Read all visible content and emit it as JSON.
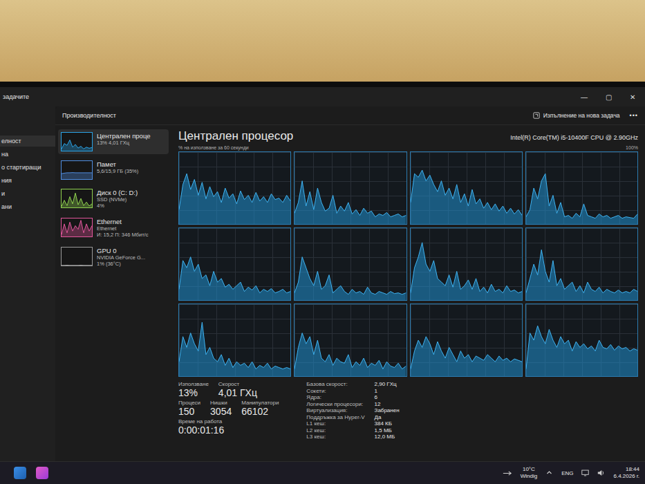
{
  "window": {
    "title": "задачите",
    "controls": [
      "—",
      "▢",
      "✕"
    ]
  },
  "nav": {
    "items": [
      {
        "label": "елност",
        "selected": true
      },
      {
        "label": "на",
        "selected": false
      },
      {
        "label": "о стартиращи",
        "selected": false
      },
      {
        "label": "ния",
        "selected": false
      },
      {
        "label": "и",
        "selected": false
      },
      {
        "label": "ани",
        "selected": false
      }
    ]
  },
  "header": {
    "title": "Производителност",
    "action": "Изпълнение на нова задача",
    "more": "•••"
  },
  "sidebar": {
    "items": [
      {
        "name": "Централен проце",
        "details": [
          "13% 4,01 ГХц"
        ],
        "selected": true,
        "color": "#2aa3e6",
        "graph": [
          10,
          40,
          30,
          60,
          20,
          35,
          15,
          25,
          10,
          20,
          14,
          18
        ]
      },
      {
        "name": "Памет",
        "details": [
          "5,6/15,9 ГБ (35%)"
        ],
        "selected": false,
        "color": "#4f8de0",
        "graph": [
          30,
          33,
          35,
          35,
          36,
          35,
          35,
          35,
          35,
          35,
          35,
          35
        ]
      },
      {
        "name": "Диск 0 (C: D:)",
        "details": [
          "SSD (NVMe)",
          "4%"
        ],
        "selected": false,
        "color": "#8fd14f",
        "graph": [
          5,
          40,
          10,
          60,
          20,
          80,
          15,
          50,
          10,
          30,
          8,
          20
        ]
      },
      {
        "name": "Ethernet",
        "details": [
          "Ethernet",
          "И: 15,2 П: 346 Мбит/с"
        ],
        "selected": false,
        "color": "#e0569b",
        "graph": [
          10,
          70,
          20,
          80,
          30,
          60,
          40,
          90,
          20,
          70,
          30,
          60
        ]
      },
      {
        "name": "GPU 0",
        "details": [
          "NVIDIA GeForce G...",
          "1% (36°C)"
        ],
        "selected": false,
        "color": "#9a9a9a",
        "graph": [
          1,
          1,
          2,
          1,
          1,
          1,
          1,
          2,
          1,
          1,
          1,
          1
        ]
      }
    ]
  },
  "panel": {
    "title": "Централен процесор",
    "model": "Intel(R) Core(TM) i5-10400F CPU @ 2.90GHz",
    "axis_label": "% на използване за 60 секунди",
    "axis_max": "100%",
    "cores": [
      {
        "values": [
          20,
          55,
          70,
          48,
          62,
          40,
          58,
          35,
          52,
          38,
          45,
          30,
          50,
          36,
          42,
          28,
          46,
          34,
          40,
          30,
          44,
          32,
          38,
          30,
          42,
          34,
          36,
          30,
          40,
          32
        ]
      },
      {
        "values": [
          15,
          30,
          60,
          25,
          45,
          20,
          50,
          30,
          18,
          22,
          40,
          15,
          25,
          18,
          30,
          14,
          20,
          12,
          22,
          15,
          18,
          10,
          14,
          12,
          16,
          10,
          12,
          14,
          10,
          12
        ]
      },
      {
        "values": [
          30,
          70,
          65,
          75,
          60,
          68,
          55,
          45,
          60,
          40,
          50,
          35,
          55,
          30,
          42,
          25,
          48,
          28,
          35,
          22,
          30,
          20,
          28,
          18,
          25,
          15,
          22,
          14,
          20,
          12
        ]
      },
      {
        "values": [
          10,
          20,
          50,
          35,
          60,
          70,
          25,
          40,
          15,
          30,
          10,
          12,
          8,
          15,
          10,
          28,
          12,
          10,
          8,
          14,
          10,
          12,
          8,
          10,
          12,
          8,
          10,
          9,
          8,
          14
        ]
      },
      {
        "values": [
          15,
          55,
          45,
          60,
          40,
          50,
          30,
          35,
          20,
          40,
          25,
          30,
          18,
          22,
          15,
          20,
          25,
          12,
          18,
          14,
          20,
          10,
          15,
          12,
          16,
          10,
          12,
          15,
          10,
          12
        ]
      },
      {
        "values": [
          10,
          25,
          60,
          45,
          30,
          20,
          40,
          15,
          20,
          35,
          10,
          15,
          20,
          12,
          8,
          15,
          10,
          12,
          8,
          18,
          10,
          8,
          12,
          10,
          8,
          12,
          9,
          10,
          8,
          10
        ]
      },
      {
        "values": [
          10,
          45,
          60,
          80,
          50,
          40,
          55,
          30,
          25,
          20,
          35,
          18,
          40,
          15,
          20,
          28,
          15,
          30,
          12,
          18,
          10,
          22,
          12,
          15,
          10,
          20,
          12,
          14,
          10,
          12
        ]
      },
      {
        "values": [
          10,
          30,
          50,
          35,
          70,
          40,
          25,
          55,
          20,
          30,
          15,
          20,
          25,
          12,
          20,
          10,
          25,
          15,
          12,
          18,
          10,
          15,
          12,
          10,
          14,
          10,
          12,
          10,
          15,
          12
        ]
      },
      {
        "values": [
          20,
          55,
          40,
          60,
          45,
          35,
          75,
          30,
          40,
          25,
          20,
          30,
          15,
          25,
          12,
          20,
          15,
          18,
          12,
          20,
          10,
          15,
          12,
          18,
          10,
          14,
          12,
          10,
          12,
          10
        ]
      },
      {
        "values": [
          10,
          40,
          60,
          45,
          55,
          30,
          50,
          25,
          20,
          30,
          15,
          25,
          20,
          18,
          30,
          12,
          20,
          15,
          25,
          12,
          18,
          15,
          22,
          10,
          20,
          14,
          12,
          18,
          10,
          14
        ]
      },
      {
        "values": [
          10,
          35,
          50,
          40,
          55,
          45,
          30,
          48,
          35,
          25,
          40,
          30,
          20,
          35,
          25,
          30,
          20,
          28,
          25,
          22,
          30,
          25,
          20,
          28,
          22,
          25,
          20,
          24,
          22,
          20
        ]
      },
      {
        "values": [
          10,
          60,
          50,
          70,
          55,
          45,
          65,
          50,
          40,
          55,
          45,
          50,
          35,
          48,
          40,
          45,
          38,
          42,
          35,
          50,
          40,
          38,
          44,
          36,
          42,
          38,
          40,
          35,
          38,
          36
        ]
      }
    ]
  },
  "stats": {
    "rows": [
      [
        {
          "label": "Използване",
          "value": "13%"
        },
        {
          "label": "Скорост",
          "value": "4,01 ГХц"
        }
      ],
      [
        {
          "label": "Процеси",
          "value": "150"
        },
        {
          "label": "Нишки",
          "value": "3054"
        },
        {
          "label": "Манипулатори",
          "value": "66102"
        }
      ],
      [
        {
          "label": "Време на работа",
          "value": "0:00:01:16"
        }
      ]
    ],
    "details": [
      {
        "label": "Базова скорост:",
        "value": "2,90 ГХц"
      },
      {
        "label": "Сокети:",
        "value": "1"
      },
      {
        "label": "Ядра:",
        "value": "6"
      },
      {
        "label": "Логически процесори:",
        "value": "12"
      },
      {
        "label": "Виртуализация:",
        "value": "Забранен"
      },
      {
        "label": "Поддръжка за Hyper-V",
        "value": "Да"
      },
      {
        "label": "L1 кеш:",
        "value": "384 КБ"
      },
      {
        "label": "L2 кеш:",
        "value": "1,5 МБ"
      },
      {
        "label": "L3 кеш:",
        "value": "12,0 МБ"
      }
    ]
  },
  "taskbar": {
    "weather": {
      "temp": "10°C",
      "condition": "Windig"
    },
    "language": "ENG",
    "time": "18:44",
    "date": "6.4.2026 г."
  }
}
